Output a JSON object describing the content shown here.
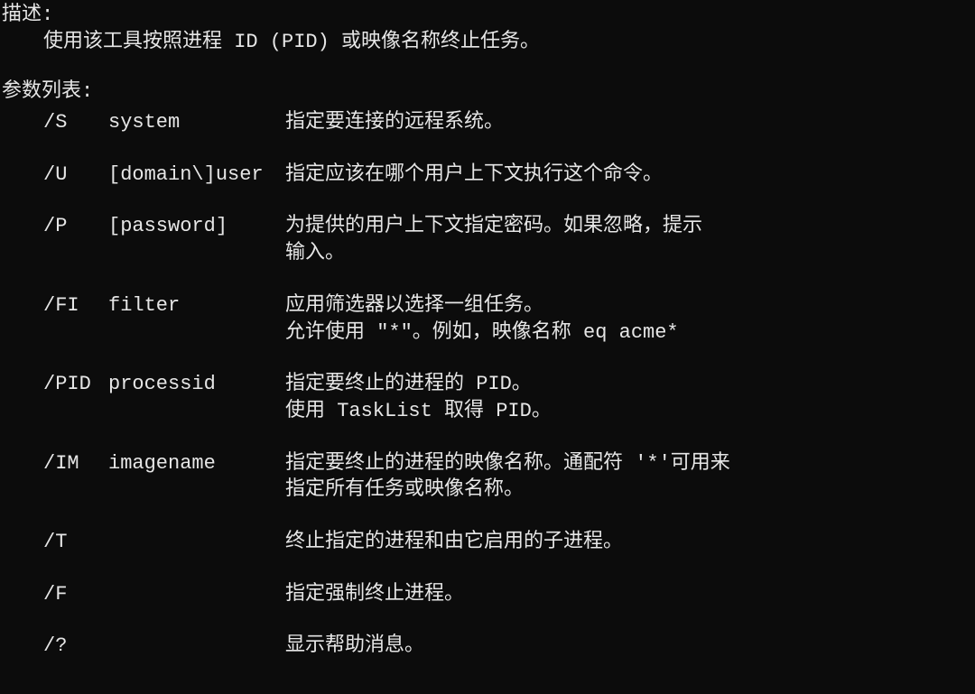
{
  "description": {
    "header": "描述:",
    "body": "使用该工具按照进程 ID (PID) 或映像名称终止任务。"
  },
  "params_header": "参数列表:",
  "params": [
    {
      "flag": "/S",
      "arg": "system",
      "desc1": "指定要连接的远程系统。",
      "desc2": ""
    },
    {
      "flag": "/U",
      "arg": "[domain\\]user",
      "desc1": "指定应该在哪个用户上下文执行这个命令。",
      "desc2": ""
    },
    {
      "flag": "/P",
      "arg": "[password]",
      "desc1": "为提供的用户上下文指定密码。如果忽略，提示",
      "desc2": "输入。"
    },
    {
      "flag": "/FI",
      "arg": "filter",
      "desc1": "应用筛选器以选择一组任务。",
      "desc2": "允许使用 \"*\"。例如，映像名称 eq acme*"
    },
    {
      "flag": "/PID",
      "arg": "processid",
      "desc1": "指定要终止的进程的 PID。",
      "desc2": "使用 TaskList 取得 PID。"
    },
    {
      "flag": "/IM",
      "arg": "imagename",
      "desc1": "指定要终止的进程的映像名称。通配符 '*'可用来",
      "desc2": "指定所有任务或映像名称。"
    },
    {
      "flag": "/T",
      "arg": "",
      "desc1": "终止指定的进程和由它启用的子进程。",
      "desc2": ""
    },
    {
      "flag": "/F",
      "arg": "",
      "desc1": "指定强制终止进程。",
      "desc2": ""
    },
    {
      "flag": "/?",
      "arg": "",
      "desc1": "显示帮助消息。",
      "desc2": ""
    }
  ]
}
